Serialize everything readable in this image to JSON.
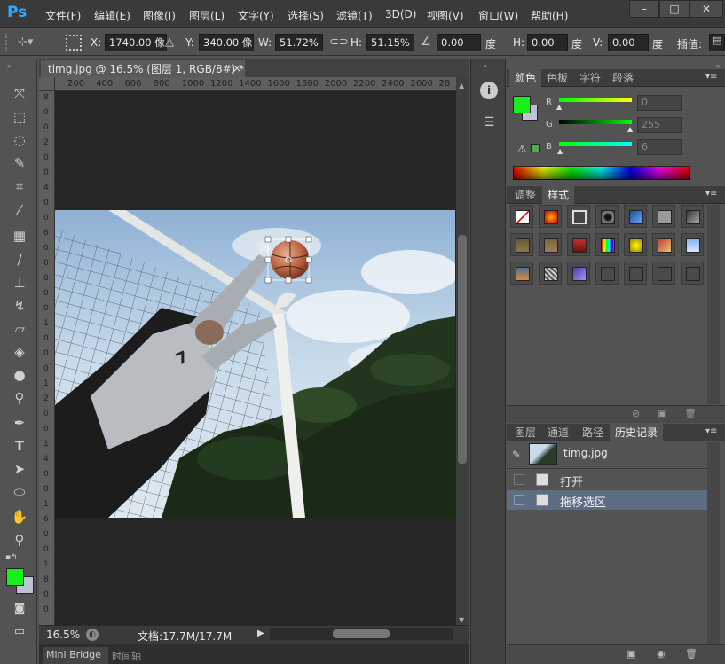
{
  "app": {
    "logo": "Ps"
  },
  "menu": [
    "文件(F)",
    "编辑(E)",
    "图像(I)",
    "图层(L)",
    "文字(Y)",
    "选择(S)",
    "滤镜(T)",
    "3D(D)",
    "视图(V)",
    "窗口(W)",
    "帮助(H)"
  ],
  "window_controls": {
    "minimize": "–",
    "restore": "□",
    "close": "✕"
  },
  "options": {
    "x_label": "X:",
    "x_value": "1740.00 像",
    "y_label": "Y:",
    "y_value": "340.00 像",
    "w_label": "W:",
    "w_value": "51.72%",
    "h_label": "H:",
    "h_value": "51.15%",
    "angle_value": "0.00",
    "angle_unit": "度",
    "hskew_label": "H:",
    "hskew_value": "0.00",
    "hskew_unit": "度",
    "vskew_label": "V:",
    "vskew_value": "0.00",
    "vskew_unit": "度",
    "interp_label": "插值:"
  },
  "document": {
    "tab_title": "timg.jpg @ 16.5% (图层 1, RGB/8#) *",
    "close": "×",
    "ruler_h": [
      "200",
      "400",
      "600",
      "800",
      "1000",
      "1200",
      "1400",
      "1600",
      "1800",
      "2000",
      "2200",
      "2400",
      "2600",
      "28"
    ],
    "ruler_v": [
      "8",
      "0",
      "0",
      "2",
      "0",
      "0",
      "4",
      "0",
      "0",
      "6",
      "0",
      "0",
      "8",
      "0",
      "0",
      "1",
      "0",
      "0",
      "0",
      "1",
      "2",
      "0",
      "0",
      "1",
      "4",
      "0",
      "0",
      "1",
      "6",
      "0",
      "0",
      "1",
      "8",
      "0",
      "0"
    ]
  },
  "status": {
    "zoom": "16.5%",
    "doc": "文档:17.7M/17.7M"
  },
  "bottom_tabs": [
    "Mini Bridge",
    "时间轴"
  ],
  "colors": {
    "foreground": "#19ef19",
    "background": "#bcc3d6",
    "accent": "#00ffff"
  },
  "color_panel": {
    "tabs": [
      "颜色",
      "色板",
      "字符",
      "段落"
    ],
    "r_label": "R",
    "r_value": "0",
    "g_label": "G",
    "g_value": "255",
    "b_label": "B",
    "b_value": "6"
  },
  "styles_panel": {
    "tabs": [
      "调整",
      "样式"
    ],
    "swatch_count": 21
  },
  "history_panel": {
    "tabs": [
      "图层",
      "通道",
      "路径",
      "历史记录"
    ],
    "snapshot": "timg.jpg",
    "items": [
      {
        "label": "打开",
        "selected": false
      },
      {
        "label": "拖移选区",
        "selected": true
      }
    ]
  }
}
